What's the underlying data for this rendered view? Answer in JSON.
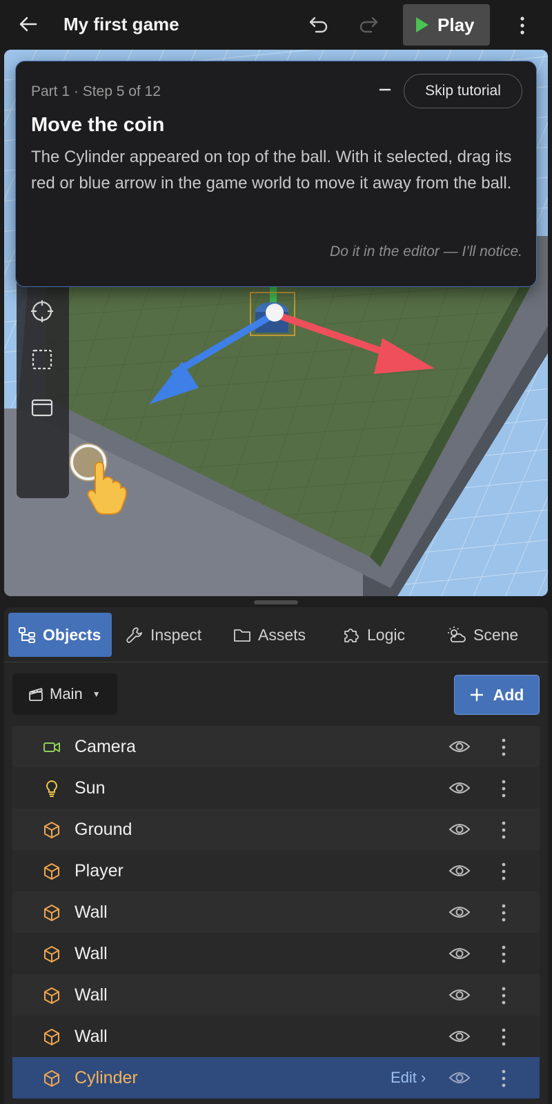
{
  "header": {
    "title": "My first game",
    "play_label": "Play"
  },
  "tutorial": {
    "step": "Part 1 · Step 5 of 12",
    "skip_label": "Skip tutorial",
    "heading": "Move the coin",
    "body": "The Cylinder appeared on top of the ball. With it selected, drag its red or blue arrow in the game world to move it away from the ball.",
    "hint": "Do it in the editor — I’ll notice."
  },
  "tabs": [
    {
      "label": "Objects",
      "icon": "hierarchy-icon",
      "active": true
    },
    {
      "label": "Inspect",
      "icon": "wrench-icon"
    },
    {
      "label": "Assets",
      "icon": "folder-icon"
    },
    {
      "label": "Logic",
      "icon": "puzzle-icon"
    },
    {
      "label": "Scene",
      "icon": "weather-icon"
    }
  ],
  "objects_panel": {
    "scene_selector": "Main",
    "add_label": "Add",
    "edit_label": "Edit ›",
    "items": [
      {
        "name": "Camera",
        "icon": "camera-icon"
      },
      {
        "name": "Sun",
        "icon": "lightbulb-icon"
      },
      {
        "name": "Ground",
        "icon": "cube-icon"
      },
      {
        "name": "Player",
        "icon": "cube-icon"
      },
      {
        "name": "Wall",
        "icon": "cube-icon"
      },
      {
        "name": "Wall",
        "icon": "cube-icon"
      },
      {
        "name": "Wall",
        "icon": "cube-icon"
      },
      {
        "name": "Wall",
        "icon": "cube-icon"
      },
      {
        "name": "Cylinder",
        "icon": "cube-icon",
        "selected": true
      }
    ]
  },
  "colors": {
    "accent": "#4471b8",
    "selected_name": "#f2b45a",
    "play_icon": "#4cc252",
    "gizmo_x": "#ef4f5b",
    "gizmo_y": "#3fb950",
    "gizmo_z": "#3f7fe8",
    "ground": "#566e45",
    "sky_grid": "#9cc3ea"
  }
}
